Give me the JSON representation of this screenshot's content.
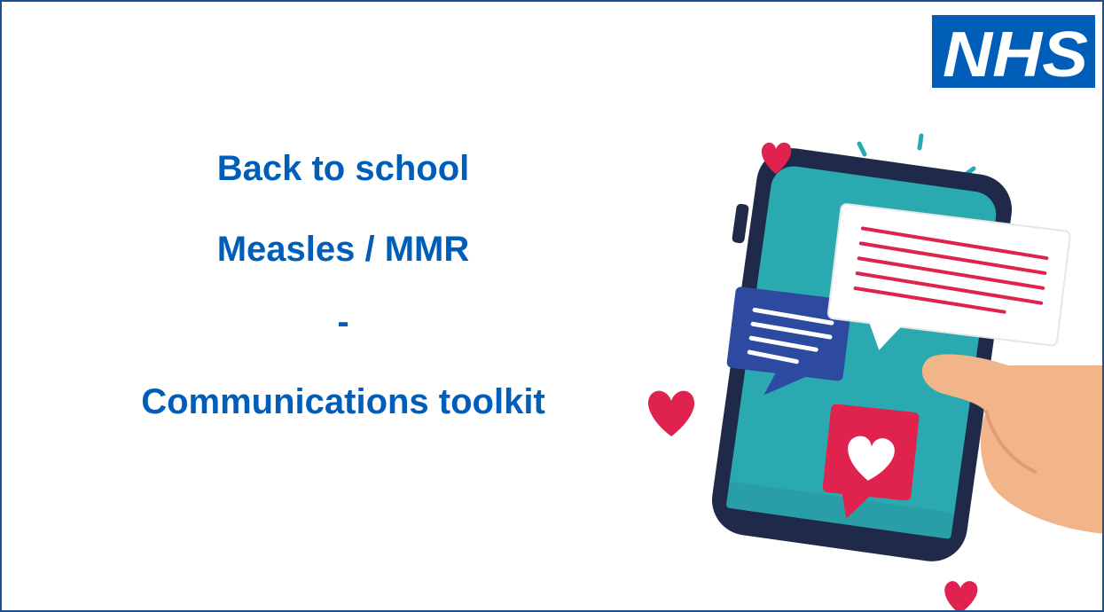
{
  "logo": {
    "text": "NHS",
    "colors": {
      "background": "#005eb8",
      "text": "#ffffff"
    }
  },
  "title": {
    "line1": "Back to school",
    "line2": "Measles / MMR",
    "line3": "-",
    "line4": "Communications toolkit"
  },
  "illustration": {
    "icons": [
      "phone-icon",
      "chat-bubble-icon",
      "heart-icon",
      "hand-icon"
    ]
  },
  "colors": {
    "title": "#005eb8",
    "frame": "#1d4f91",
    "phone_screen": "#2aaab0",
    "phone_body": "#1f2a4a",
    "heart": "#e0224e",
    "blue_bubble": "#2d4aa0",
    "hand": "#f2b489"
  }
}
